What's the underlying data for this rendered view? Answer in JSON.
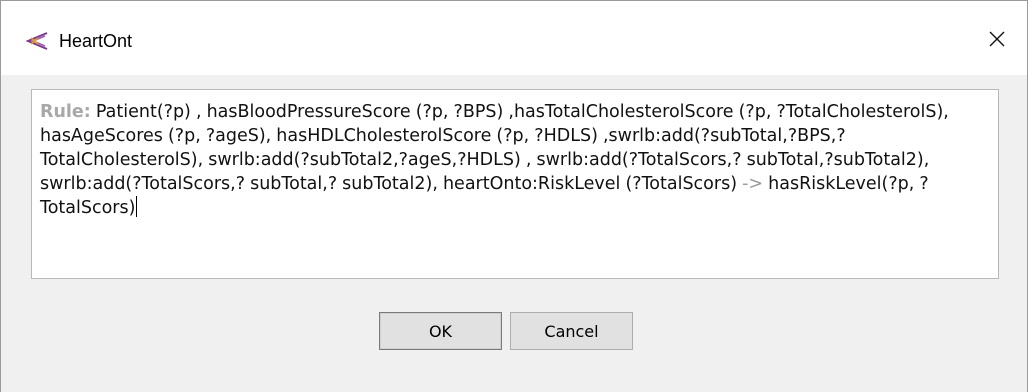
{
  "window": {
    "title": "HeartOnt",
    "icon": "protege-logo-icon",
    "close_glyph": "✕"
  },
  "editor": {
    "rule_label": "Rule:",
    "rule_body": "Patient(?p) , hasBloodPressureScore (?p, ?BPS) ,hasTotalCholesterolScore (?p, ?TotalCholesterolS), hasAgeScores (?p, ?ageS), hasHDLCholesterolScore (?p, ?HDLS) ,swrlb:add(?subTotal,?BPS,?TotalCholesterolS), swrlb:add(?subTotal2,?ageS,?HDLS) , swrlb:add(?TotalScors,? subTotal,?subTotal2), swrlb:add(?TotalScors,? subTotal,? subTotal2), heartOnto:RiskLevel (?TotalScors)",
    "arrow": " -> ",
    "rule_head": "hasRiskLevel(?p, ?TotalScors)"
  },
  "buttons": {
    "ok_label": "OK",
    "cancel_label": "Cancel"
  },
  "colors": {
    "label_gray": "#a8a8a8",
    "window_bg": "#f0f0f0",
    "button_bg": "#e1e1e1"
  }
}
